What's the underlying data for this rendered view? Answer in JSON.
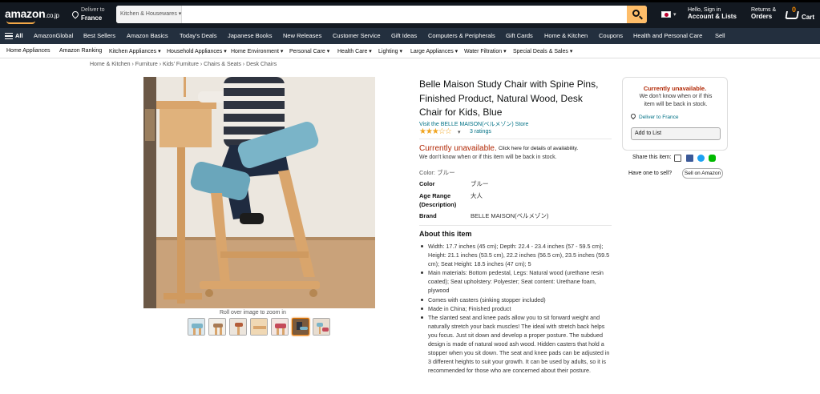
{
  "header": {
    "logo_text": "amazon",
    "logo_tld": ".co.jp",
    "deliver_line1": "Deliver to",
    "deliver_line2": "France",
    "search_category": "Kitchen & Housewares",
    "search_value": "",
    "account_line1": "Hello, Sign in",
    "account_line2": "Account & Lists",
    "orders_line1": "Returns &",
    "orders_line2": "Orders",
    "cart_count": "0",
    "cart_label": "Cart"
  },
  "nav": {
    "all_label": "All",
    "items": [
      "AmazonGlobal",
      "Best Sellers",
      "Amazon Basics",
      "Today's Deals",
      "Japanese Books",
      "New Releases",
      "Customer Service",
      "Gift Ideas",
      "Computers & Peripherals",
      "Gift Cards",
      "Home & Kitchen",
      "Coupons",
      "Health and Personal Care",
      "Sell"
    ]
  },
  "subnav": {
    "items": [
      "Home Appliances",
      "Amazon Ranking",
      "Kitchen Appliances",
      "Household Appliances",
      "Home Environment",
      "Personal Care",
      "Health Care",
      "Lighting",
      "Large Appliances",
      "Water Filtration",
      "Special Deals & Sales"
    ]
  },
  "breadcrumb": "Home & Kitchen › Furniture › Kids' Furniture › Chairs & Seats › Desk Chairs",
  "gallery": {
    "hover_text": "Roll over image to zoom in",
    "thumb_count": 7,
    "selected_index": 5
  },
  "product": {
    "title": "Belle Maison Study Chair with Spine Pins, Finished Product, Natural Wood, Desk Chair for Kids, Blue",
    "visit_store": "Visit the BELLE MAISON(ベルメゾン) Store",
    "stars": "★★★☆☆",
    "rating_value": 3.5,
    "ratings_text": "3 ratings",
    "unavailable": "Currently unavailable.",
    "unavailable_link": "Click here for details of availability.",
    "unavailable_sub": "We don't know when or if this item will be back in stock.",
    "color_line": "Color: ブルー",
    "specs": [
      {
        "key": "Color",
        "value": "ブルー"
      },
      {
        "key": "Age Range (Description)",
        "value": "大人"
      },
      {
        "key": "Brand",
        "value": "BELLE MAISON(ベルメゾン)"
      }
    ],
    "about_heading": "About this item",
    "bullets": [
      "Width: 17.7 inches (45 cm); Depth: 22.4 - 23.4 inches (57 - 59.5 cm); Height: 21.1 inches (53.5 cm), 22.2 inches (56.5 cm), 23.5 inches (59.5 cm); Seat Height: 18.5 inches (47 cm); 5",
      "Main materials: Bottom pedestal, Legs: Natural wood (urethane resin coated); Seat upholstery: Polyester; Seat content: Urethane foam, plywood",
      "Comes with casters (sinking stopper included)",
      "Made in China; Finished product",
      "The slanted seat and knee pads allow you to sit forward weight and naturally stretch your back muscles! The ideal with stretch back helps you focus. Just sit down and develop a proper posture. The subdued design is made of natural wood ash wood. Hidden casters that hold a stopper when you sit down. The seat and knee pads can be adjusted in 3 different heights to suit your growth. It can be used by adults, so it is recommended for those who are concerned about their posture."
    ]
  },
  "buybox": {
    "title": "Currently unavailable.",
    "subtitle": "We don't know when or if this item will be back in stock.",
    "deliver": "Deliver to France",
    "add_to_list": "Add to List",
    "share_label": "Share this item:",
    "have_one": "Have one to sell?",
    "sell_button": "Sell on Amazon"
  },
  "colors": {
    "header_bg": "#131921",
    "nav_bg": "#232f3e",
    "search_button": "#febd69",
    "link": "#007185",
    "unavailable": "#b12704",
    "star": "#f0a41f",
    "chair_seat": "#7ab4c8",
    "wood": "#d9a56c"
  },
  "icons": [
    "location-pin-icon",
    "search-icon",
    "japan-flag-icon",
    "cart-icon",
    "hamburger-menu-icon",
    "email-icon",
    "facebook-icon",
    "twitter-icon",
    "line-icon"
  ]
}
